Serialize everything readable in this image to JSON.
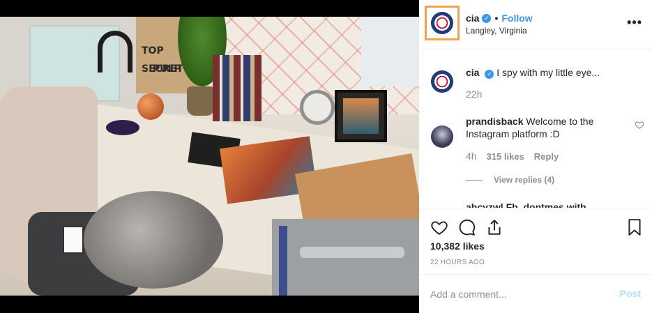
{
  "header": {
    "username": "cia",
    "separator": "•",
    "follow_label": "Follow",
    "location": "Langley, Virginia",
    "more_label": "•••"
  },
  "photo": {
    "bag_line1": "TOP SECRET",
    "bag_line2": "PULP"
  },
  "caption": {
    "username": "cia",
    "text": "I spy with my little eye...",
    "time": "22h"
  },
  "comments": [
    {
      "username": "prandisback",
      "text": "Welcome to the Instagram platform :D",
      "time": "4h",
      "likes": "315 likes",
      "reply_label": "Reply",
      "view_replies": "View replies (4)"
    }
  ],
  "partial_comment": "abcyzwl Fb, dontmes with ..",
  "post": {
    "likes": "10,382 likes",
    "time_ago": "22 HOURS AGO"
  },
  "add_comment": {
    "placeholder": "Add a comment...",
    "post_label": "Post"
  },
  "colors": {
    "accent": "#3897f0",
    "highlight": "#f5a04b",
    "post_disabled": "#b2dffc"
  }
}
